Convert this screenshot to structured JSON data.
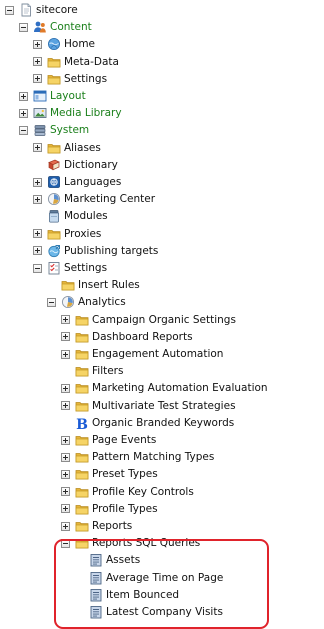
{
  "tree": {
    "items": [
      {
        "label": "sitecore",
        "icon": "page-icon",
        "level": 0,
        "expander": "expanded",
        "label_color": "#111111"
      },
      {
        "label": "Content",
        "icon": "content-people-icon",
        "level": 1,
        "expander": "expanded",
        "label_color": "#1a7f1a"
      },
      {
        "label": "Home",
        "icon": "home-globe-icon",
        "level": 2,
        "expander": "collapsed",
        "label_color": "#111111"
      },
      {
        "label": "Meta-Data",
        "icon": "folder-icon",
        "level": 2,
        "expander": "collapsed",
        "label_color": "#111111"
      },
      {
        "label": "Settings",
        "icon": "folder-icon",
        "level": 2,
        "expander": "collapsed",
        "label_color": "#111111"
      },
      {
        "label": "Layout",
        "icon": "layout-window-icon",
        "level": 1,
        "expander": "collapsed",
        "label_color": "#1a7f1a"
      },
      {
        "label": "Media Library",
        "icon": "media-library-icon",
        "level": 1,
        "expander": "collapsed",
        "label_color": "#1a7f1a"
      },
      {
        "label": "System",
        "icon": "system-database-icon",
        "level": 1,
        "expander": "expanded",
        "label_color": "#1a7f1a"
      },
      {
        "label": "Aliases",
        "icon": "folder-icon",
        "level": 2,
        "expander": "collapsed",
        "label_color": "#111111"
      },
      {
        "label": "Dictionary",
        "icon": "dictionary-book-icon",
        "level": 2,
        "expander": "none",
        "label_color": "#111111"
      },
      {
        "label": "Languages",
        "icon": "languages-icon",
        "level": 2,
        "expander": "collapsed",
        "label_color": "#111111"
      },
      {
        "label": "Marketing Center",
        "icon": "marketing-center-icon",
        "level": 2,
        "expander": "collapsed",
        "label_color": "#111111"
      },
      {
        "label": "Modules",
        "icon": "modules-jar-icon",
        "level": 2,
        "expander": "none",
        "label_color": "#111111"
      },
      {
        "label": "Proxies",
        "icon": "folder-icon",
        "level": 2,
        "expander": "collapsed",
        "label_color": "#111111"
      },
      {
        "label": "Publishing targets",
        "icon": "publishing-targets-icon",
        "level": 2,
        "expander": "collapsed",
        "label_color": "#111111"
      },
      {
        "label": "Settings",
        "icon": "settings-checklist-icon",
        "level": 2,
        "expander": "expanded",
        "label_color": "#111111"
      },
      {
        "label": "Insert Rules",
        "icon": "folder-icon",
        "level": 3,
        "expander": "none",
        "label_color": "#111111"
      },
      {
        "label": "Analytics",
        "icon": "analytics-icon",
        "level": 3,
        "expander": "expanded",
        "label_color": "#111111"
      },
      {
        "label": "Campaign Organic Settings",
        "icon": "folder-icon",
        "level": 4,
        "expander": "collapsed",
        "label_color": "#111111"
      },
      {
        "label": "Dashboard Reports",
        "icon": "folder-icon",
        "level": 4,
        "expander": "collapsed",
        "label_color": "#111111"
      },
      {
        "label": "Engagement Automation",
        "icon": "folder-icon",
        "level": 4,
        "expander": "collapsed",
        "label_color": "#111111"
      },
      {
        "label": "Filters",
        "icon": "folder-icon",
        "level": 4,
        "expander": "none",
        "label_color": "#111111"
      },
      {
        "label": "Marketing Automation Evaluation",
        "icon": "folder-icon",
        "level": 4,
        "expander": "collapsed",
        "label_color": "#111111"
      },
      {
        "label": "Multivariate Test Strategies",
        "icon": "folder-icon",
        "level": 4,
        "expander": "collapsed",
        "label_color": "#111111"
      },
      {
        "label": "Organic Branded Keywords",
        "icon": "bing-b-icon",
        "level": 4,
        "expander": "none",
        "label_color": "#111111"
      },
      {
        "label": "Page Events",
        "icon": "folder-icon",
        "level": 4,
        "expander": "collapsed",
        "label_color": "#111111"
      },
      {
        "label": "Pattern Matching Types",
        "icon": "folder-icon",
        "level": 4,
        "expander": "collapsed",
        "label_color": "#111111"
      },
      {
        "label": "Preset Types",
        "icon": "folder-icon",
        "level": 4,
        "expander": "collapsed",
        "label_color": "#111111"
      },
      {
        "label": "Profile Key Controls",
        "icon": "folder-icon",
        "level": 4,
        "expander": "collapsed",
        "label_color": "#111111"
      },
      {
        "label": "Profile Types",
        "icon": "folder-icon",
        "level": 4,
        "expander": "collapsed",
        "label_color": "#111111"
      },
      {
        "label": "Reports",
        "icon": "folder-icon",
        "level": 4,
        "expander": "collapsed",
        "label_color": "#111111"
      },
      {
        "label": "Reports SQL Queries",
        "icon": "folder-icon",
        "level": 4,
        "expander": "expanded",
        "label_color": "#111111"
      },
      {
        "label": "Assets",
        "icon": "sql-query-icon",
        "level": 5,
        "expander": "none",
        "label_color": "#111111"
      },
      {
        "label": "Average Time on Page",
        "icon": "sql-query-icon",
        "level": 5,
        "expander": "none",
        "label_color": "#111111"
      },
      {
        "label": "Item Bounced",
        "icon": "sql-query-icon",
        "level": 5,
        "expander": "none",
        "label_color": "#111111"
      },
      {
        "label": "Latest Company Visits",
        "icon": "sql-query-icon",
        "level": 5,
        "expander": "none",
        "label_color": "#111111"
      }
    ]
  },
  "colors": {
    "green_label": "#1a7f1a",
    "highlight_border": "#e0232b",
    "folder_fill": "#f3cf55"
  }
}
